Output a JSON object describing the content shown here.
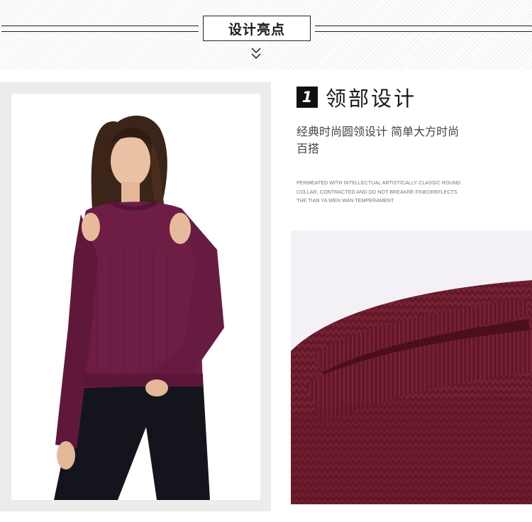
{
  "header": {
    "title": "设计亮点",
    "chevron_icon": "double-chevron-down-icon"
  },
  "section": {
    "number": "1",
    "title": "领部设计",
    "description": "经典时尚圆领设计 简单大方时尚百搭",
    "english_text": "Permeated with intellectual artistically classic round collar, contracted and do not breakre finedreflects the tian ya wen wan temperament"
  },
  "colors": {
    "sweater": "#6e1d45",
    "detail_knit": "#6a1b2c",
    "jeans": "#14151c"
  },
  "images": {
    "model_photo": "model-wearing-purple-cold-shoulder-sweater",
    "detail_photo": "knit-round-collar-closeup"
  }
}
